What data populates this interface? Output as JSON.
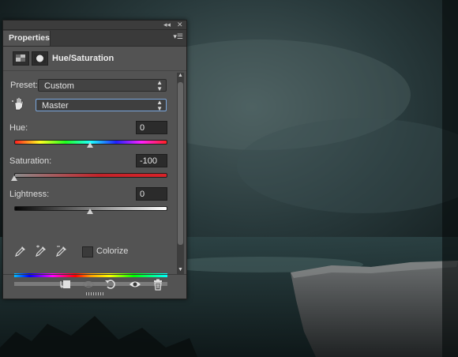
{
  "panel": {
    "tab_label": "Properties",
    "title": "Hue/Saturation",
    "collapse_icon": "double-chevron-icon",
    "close_icon": "close-icon",
    "menu_icon": "panel-menu-icon"
  },
  "preset": {
    "label": "Preset:",
    "value": "Custom"
  },
  "channel": {
    "value": "Master"
  },
  "hue": {
    "label": "Hue:",
    "value": "0",
    "level": 0.5
  },
  "saturation": {
    "label": "Saturation:",
    "value": "-100",
    "level": 0.0
  },
  "lightness": {
    "label": "Lightness:",
    "value": "0",
    "level": 0.5
  },
  "colorize": {
    "label": "Colorize",
    "checked": false
  },
  "colors": {
    "panel_bg": "#535353",
    "focus_border": "#7aa6dc",
    "saturation_track": "#c2242a"
  }
}
